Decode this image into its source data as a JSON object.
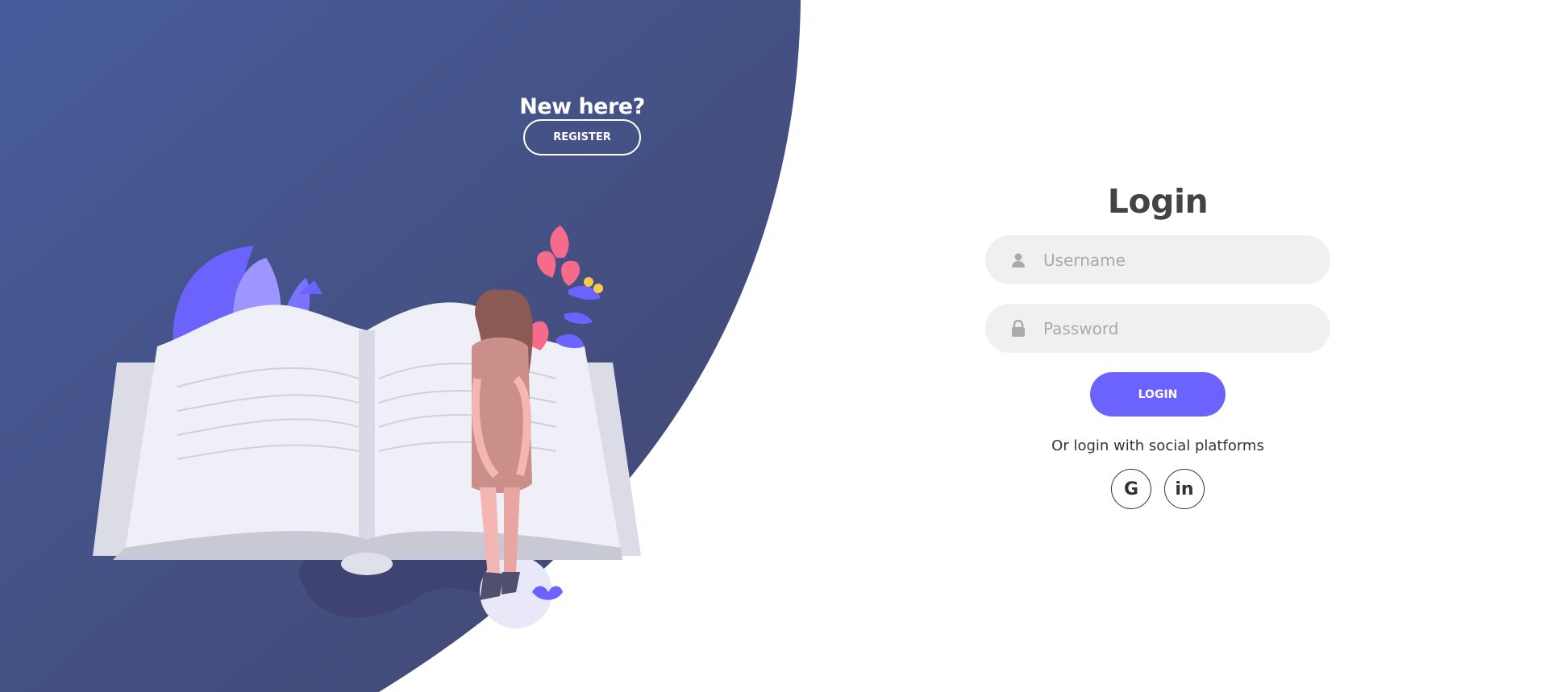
{
  "panel": {
    "title": "New here?",
    "register_label": "REGISTER"
  },
  "form": {
    "title": "Login",
    "username_placeholder": "Username",
    "password_placeholder": "Password",
    "login_label": "LOGIN",
    "social_text": "Or login with social platforms",
    "social": [
      {
        "icon": "google-icon",
        "label": "G"
      },
      {
        "icon": "linkedin-icon",
        "label": "in"
      }
    ]
  },
  "colors": {
    "panel_gradient_start": "#445a9a",
    "panel_gradient_end": "#434470",
    "accent": "#6c63ff",
    "input_bg": "#f0f0f0",
    "title_text": "#444444"
  }
}
